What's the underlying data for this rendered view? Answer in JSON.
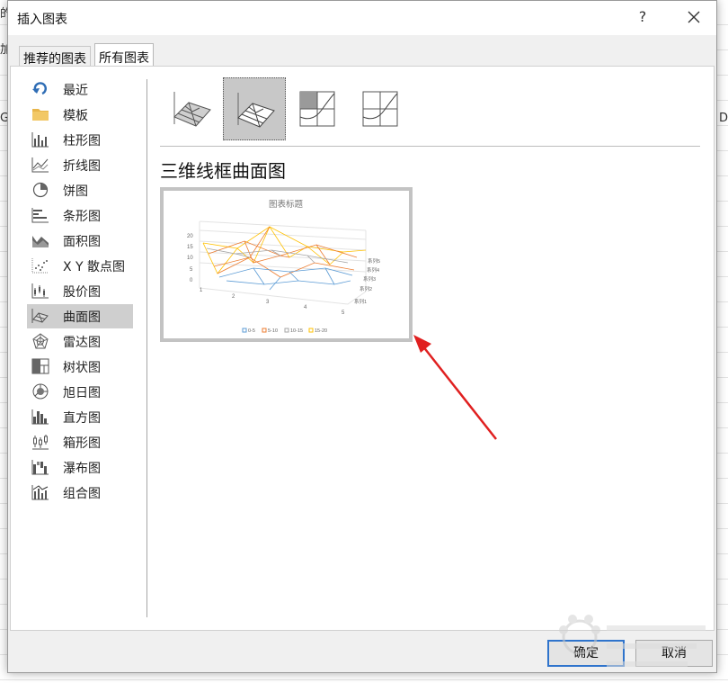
{
  "background": {
    "fragments": [
      "的",
      "加",
      "G",
      "D"
    ]
  },
  "dialog": {
    "title": "插入图表",
    "help_label": "?",
    "tabs": [
      {
        "label": "推荐的图表",
        "active": false
      },
      {
        "label": "所有图表",
        "active": true
      }
    ],
    "sidebar": {
      "items": [
        {
          "label": "最近",
          "icon": "undo-icon"
        },
        {
          "label": "模板",
          "icon": "folder-icon"
        },
        {
          "label": "柱形图",
          "icon": "column-chart-icon"
        },
        {
          "label": "折线图",
          "icon": "line-chart-icon"
        },
        {
          "label": "饼图",
          "icon": "pie-chart-icon"
        },
        {
          "label": "条形图",
          "icon": "bar-chart-icon"
        },
        {
          "label": "面积图",
          "icon": "area-chart-icon"
        },
        {
          "label": "X Y 散点图",
          "icon": "scatter-chart-icon"
        },
        {
          "label": "股价图",
          "icon": "stock-chart-icon"
        },
        {
          "label": "曲面图",
          "icon": "surface-chart-icon",
          "selected": true
        },
        {
          "label": "雷达图",
          "icon": "radar-chart-icon"
        },
        {
          "label": "树状图",
          "icon": "treemap-chart-icon"
        },
        {
          "label": "旭日图",
          "icon": "sunburst-chart-icon"
        },
        {
          "label": "直方图",
          "icon": "histogram-chart-icon"
        },
        {
          "label": "箱形图",
          "icon": "box-chart-icon"
        },
        {
          "label": "瀑布图",
          "icon": "waterfall-chart-icon"
        },
        {
          "label": "组合图",
          "icon": "combo-chart-icon"
        }
      ]
    },
    "subtypes": [
      {
        "icon": "surface-3d-icon",
        "selected": false
      },
      {
        "icon": "wireframe-3d-surface-icon",
        "selected": true
      },
      {
        "icon": "contour-icon",
        "selected": false
      },
      {
        "icon": "wireframe-contour-icon",
        "selected": false
      }
    ],
    "selected_chart_name": "三维线框曲面图",
    "preview": {
      "title": "图表标题",
      "y_ticks": [
        "20",
        "15",
        "10",
        "5",
        "0"
      ],
      "x_ticks": [
        "1",
        "2",
        "3",
        "4",
        "5"
      ],
      "series": [
        "系列5",
        "系列4",
        "系列3",
        "系列2",
        "系列1"
      ],
      "legend": [
        {
          "label": "0-5",
          "color": "#5b9bd5"
        },
        {
          "label": "5-10",
          "color": "#ed7d31"
        },
        {
          "label": "10-15",
          "color": "#a5a5a5"
        },
        {
          "label": "15-20",
          "color": "#ffc000"
        }
      ]
    },
    "buttons": {
      "ok": "确定",
      "cancel": "取消"
    }
  },
  "colors": {
    "annotation_arrow": "#e02020",
    "primary_button_border": "#2f74cc"
  }
}
